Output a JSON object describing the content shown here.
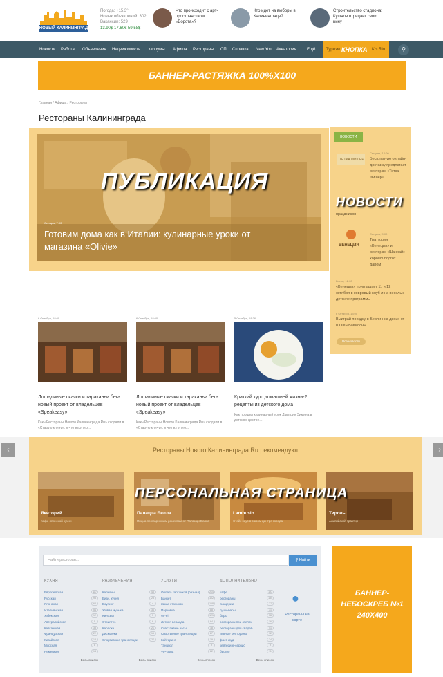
{
  "header": {
    "logo_text": "НОВЫЙ КАЛИНИНГРАД",
    "weather": [
      "Погода: +15.3°",
      "Новых объявлений: 302",
      "Вакансии: 529"
    ],
    "rates": "13.90$ 17.60€ 59.58$",
    "news": [
      {
        "text": "Что происходит с арт-пространством «Ворота»?"
      },
      {
        "text": "Кто идет на выборы в Калининграде?"
      },
      {
        "text": "Строительство стадиона: Кушнов отрицает свою вину"
      }
    ]
  },
  "nav": {
    "items": [
      "Новости",
      "Работа",
      "Объявления",
      "Недвижимость",
      "Форумы",
      "Афиша",
      "Рестораны",
      "СП",
      "Справка",
      "New You",
      "Акватория",
      "Ещё..."
    ],
    "button_left": "Туризм",
    "button_big": "КНОПКА",
    "button_right": "Kis Rio"
  },
  "banner": "БАННЕР-РАСТЯЖКА 100%Х100",
  "breadcrumb": "Главная / Афиша / Рестораны",
  "page_title": "Рестораны Калининграда",
  "publication": {
    "label": "ПУБЛИКАЦИЯ",
    "date": "Сегодня, 7:00",
    "title": "Готовим дома как в Италии: кулинарные уроки от магазина «Olivie»"
  },
  "news_col": {
    "head": "НОВОСТИ",
    "label": "НОВОСТИ",
    "items": [
      {
        "date": "Сегодня, 12:00",
        "text": "Бесплатную онлайн-доставку предлагает ресторан «Тетка Фишер»"
      },
      {
        "date": "Сегодня, 11:00",
        "text": "праздников"
      },
      {
        "date": "Сегодня, 9:00",
        "text": "Траттория «Венеция» и ресторан «Шанхай» хорошо подгот даром"
      },
      {
        "date": "Вчера, 12:00",
        "text": "«Венеция» приглашает 11 и 12 октября в ковровый клуб и на веселые детские программы"
      },
      {
        "date": "6 Октября, 13:00",
        "text": "Выиграй поездку в Берлин на двоих от ШОФ «Вавилон»"
      }
    ],
    "more": "Все новости"
  },
  "cards": [
    {
      "date": "6 Октября, 18:00",
      "title": "Лошадиные скачки и тараканьи бега: новый проект от владельцев «Speakeasy»",
      "desc": "Как «Рестораны Нового Калининграда.Ru» сходили в «Старую клячу», и что из этого..."
    },
    {
      "date": "6 Октября, 18:00",
      "title": "Лошадиные скачки и тараканьи бега: новый проект от владельцев «Speakeasy»",
      "desc": "Как «Рестораны Нового Калининграда.Ru» сходили в «Старую клячу», и что из этого..."
    },
    {
      "date": "5 Октября, 18:36",
      "title": "Краткий курс домашней жизни-2: рецепты из детского дома",
      "desc": "Как прошел кулинарный урок Дмитрия Зимина в детском центре..."
    }
  ],
  "recommend": {
    "title": "Рестораны Нового Калининграда.Ru рекомендуют",
    "label": "ПЕРСОНАЛЬНАЯ СТРАНИЦА",
    "items": [
      {
        "name": "Якиторий",
        "sub": "Кафе японской кухни"
      },
      {
        "name": "Палацца Белла",
        "sub": "Пицца по старинным рецептам от Палацци Белла"
      },
      {
        "name": "Lambusin",
        "sub": "Стейк хаус в самом центре города"
      },
      {
        "name": "Тироль",
        "sub": "Альпийский трактир"
      }
    ]
  },
  "search": {
    "placeholder": "Найти ресторан...",
    "button": "Найти",
    "map_text": "Рестораны на карте",
    "more": "Весь список",
    "columns": [
      {
        "head": "КУХНЯ",
        "rows": [
          [
            "Европейская",
            "117"
          ],
          [
            "Русская",
            "98"
          ],
          [
            "Японская",
            "62"
          ],
          [
            "Итальянская",
            "54"
          ],
          [
            "Узбекская",
            "12"
          ],
          [
            "Австралийская",
            "5"
          ],
          [
            "Кавказская",
            "33"
          ],
          [
            "Французская",
            "22"
          ],
          [
            "Китайская",
            "18"
          ],
          [
            "Морская",
            "8"
          ],
          [
            "Немецкая",
            "14"
          ]
        ]
      },
      {
        "head": "РАЗВЛЕЧЕНИЯ",
        "rows": [
          [
            "Кальяны",
            "45"
          ],
          [
            "Бизн. кухня",
            "28"
          ],
          [
            "Боулинг",
            "4"
          ],
          [
            "Живая музыка",
            "36"
          ],
          [
            "Кинозал",
            "3"
          ],
          [
            "Стриптиз",
            "6"
          ],
          [
            "Караоке",
            "21"
          ],
          [
            "Дискотека",
            "15"
          ],
          [
            "Спортивные трансляции",
            "27"
          ]
        ]
      },
      {
        "head": "УСЛУГИ",
        "rows": [
          [
            "Оплата карточкой (безнал)",
            "214"
          ],
          [
            "Банкет",
            "102"
          ],
          [
            "Заказ столиков",
            "168"
          ],
          [
            "Парковка",
            "88"
          ],
          [
            "Wi-Fi",
            "121"
          ],
          [
            "Летняя веранда",
            "64"
          ],
          [
            "Счастливые часы",
            "18"
          ],
          [
            "Спортивные трансляции",
            "27"
          ],
          [
            "Кейтеринг",
            "19"
          ],
          [
            "Танцпол",
            "9"
          ],
          [
            "VIP-зона",
            "22"
          ]
        ]
      },
      {
        "head": "ДОПОЛНИТЕЛЬНО",
        "rows": [
          [
            "кафе",
            "197"
          ],
          [
            "рестораны",
            "134"
          ],
          [
            "пиццерии",
            "27"
          ],
          [
            "суши-бары",
            "31"
          ],
          [
            "бары",
            "58"
          ],
          [
            "рестораны при отелях",
            "16"
          ],
          [
            "рестораны для свадеб",
            "41"
          ],
          [
            "пивные рестораны",
            "12"
          ],
          [
            "фаст-фуд",
            "24"
          ],
          [
            "кейтеринг-сервис",
            "9"
          ],
          [
            "бистро",
            "11"
          ]
        ]
      }
    ]
  },
  "sky_banner": "БАННЕР-НЕБОСКРЕБ №1 240Х400"
}
